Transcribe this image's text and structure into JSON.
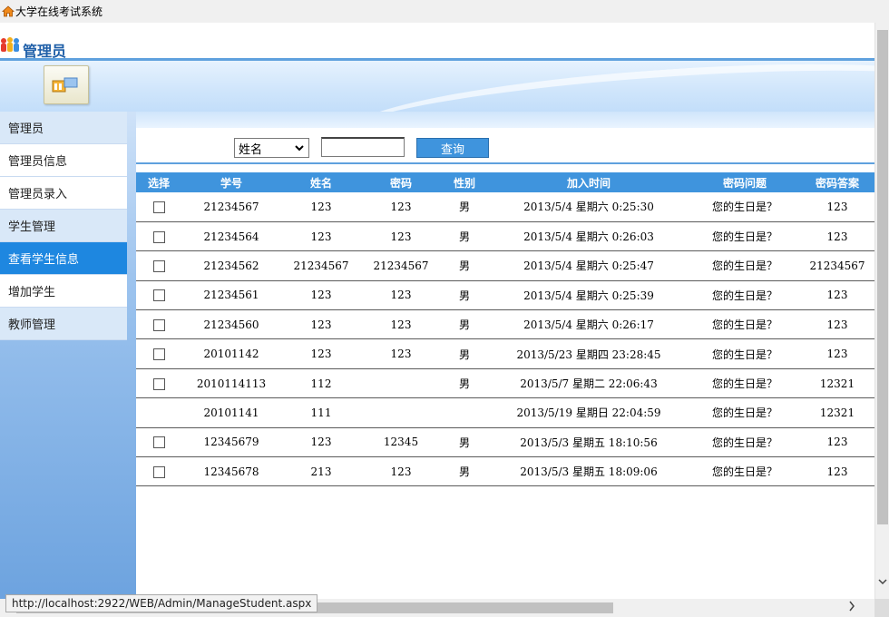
{
  "window": {
    "title": "大学在线考试系统"
  },
  "header": {
    "title": "管理员"
  },
  "sidebar": {
    "items": [
      {
        "label": "管理员",
        "kind": "group"
      },
      {
        "label": "管理员信息",
        "kind": "sub"
      },
      {
        "label": "管理员录入",
        "kind": "sub"
      },
      {
        "label": "学生管理",
        "kind": "group"
      },
      {
        "label": "查看学生信息",
        "kind": "active"
      },
      {
        "label": "增加学生",
        "kind": "sub"
      },
      {
        "label": "教师管理",
        "kind": "group"
      }
    ]
  },
  "search": {
    "field_selected": "姓名",
    "input_value": "",
    "button_label": "查询"
  },
  "table": {
    "columns": [
      "选择",
      "学号",
      "姓名",
      "密码",
      "性别",
      "加入时间",
      "密码问题",
      "密码答案"
    ],
    "rows": [
      {
        "checkbox": true,
        "id": "21234567",
        "name": "123",
        "password": "123",
        "gender": "男",
        "joined": "2013/5/4 星期六 0:25:30",
        "question": "您的生日是？",
        "answer": "123"
      },
      {
        "checkbox": true,
        "id": "21234564",
        "name": "123",
        "password": "123",
        "gender": "男",
        "joined": "2013/5/4 星期六 0:26:03",
        "question": "您的生日是？",
        "answer": "123"
      },
      {
        "checkbox": true,
        "id": "21234562",
        "name": "21234567",
        "password": "21234567",
        "gender": "男",
        "joined": "2013/5/4 星期六 0:25:47",
        "question": "您的生日是？",
        "answer": "21234567"
      },
      {
        "checkbox": true,
        "id": "21234561",
        "name": "123",
        "password": "123",
        "gender": "男",
        "joined": "2013/5/4 星期六 0:25:39",
        "question": "您的生日是？",
        "answer": "123"
      },
      {
        "checkbox": true,
        "id": "21234560",
        "name": "123",
        "password": "123",
        "gender": "男",
        "joined": "2013/5/4 星期六 0:26:17",
        "question": "您的生日是？",
        "answer": "123"
      },
      {
        "checkbox": true,
        "id": "20101142",
        "name": "123",
        "password": "123",
        "gender": "男",
        "joined": "2013/5/23 星期四 23:28:45",
        "question": "您的生日是？",
        "answer": "123"
      },
      {
        "checkbox": true,
        "id": "2010114113",
        "name": "112",
        "password": "",
        "gender": "男",
        "joined": "2013/5/7 星期二 22:06:43",
        "question": "您的生日是？",
        "answer": "12321"
      },
      {
        "checkbox": false,
        "id": "20101141",
        "name": "111",
        "password": "",
        "gender": "",
        "joined": "2013/5/19 星期日 22:04:59",
        "question": "您的生日是？",
        "answer": "12321"
      },
      {
        "checkbox": true,
        "id": "12345679",
        "name": "123",
        "password": "12345",
        "gender": "男",
        "joined": "2013/5/3 星期五 18:10:56",
        "question": "您的生日是？",
        "answer": "123"
      },
      {
        "checkbox": true,
        "id": "12345678",
        "name": "213",
        "password": "123",
        "gender": "男",
        "joined": "2013/5/3 星期五 18:09:06",
        "question": "您的生日是？",
        "answer": "123"
      }
    ]
  },
  "status": {
    "url": "http://localhost:2922/WEB/Admin/ManageStudent.aspx"
  },
  "colors": {
    "accent": "#3f94dd",
    "active_nav": "#1e87e0",
    "title_blue": "#1f5fa8"
  }
}
